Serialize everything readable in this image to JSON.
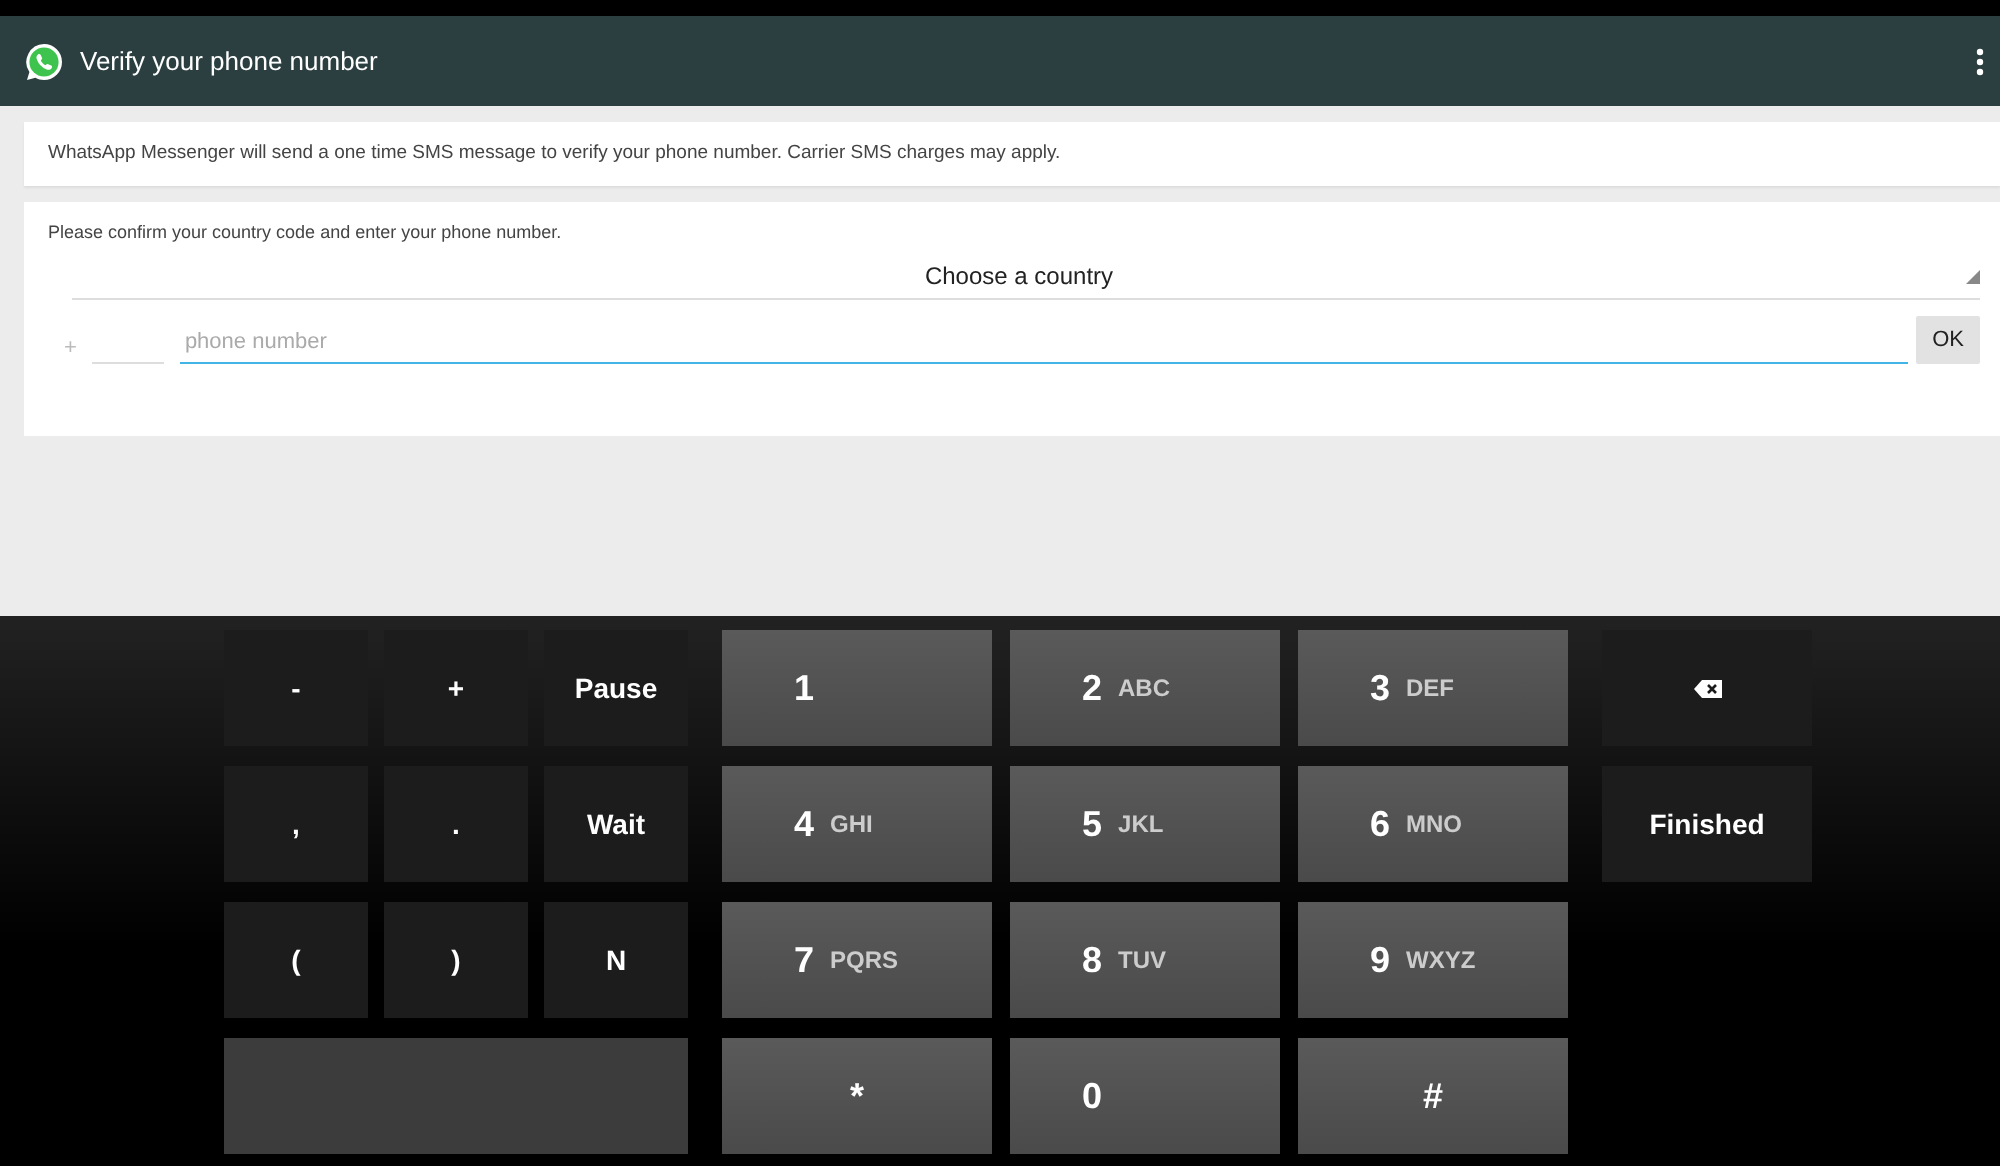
{
  "header": {
    "title": "Verify your phone number"
  },
  "notice": "WhatsApp Messenger will send a one time SMS message to verify your phone number. Carrier SMS charges may apply.",
  "form": {
    "instruction": "Please confirm your country code and enter your phone number.",
    "country": "Choose a country",
    "plus": "+",
    "phone": {
      "placeholder": "phone number",
      "focused": true
    },
    "ok": "OK"
  },
  "keypad": {
    "rows": [
      [
        {
          "kind": "sym",
          "label": "-"
        },
        {
          "kind": "sym",
          "label": "+"
        },
        {
          "kind": "sym",
          "label": "Pause"
        },
        {
          "kind": "digit",
          "label": "1"
        },
        {
          "kind": "digit",
          "label": "2",
          "letters": "ABC"
        },
        {
          "kind": "digit",
          "label": "3",
          "letters": "DEF"
        },
        {
          "kind": "backspace"
        }
      ],
      [
        {
          "kind": "sym",
          "label": ","
        },
        {
          "kind": "sym",
          "label": "."
        },
        {
          "kind": "sym",
          "label": "Wait"
        },
        {
          "kind": "digit",
          "label": "4",
          "letters": "GHI"
        },
        {
          "kind": "digit",
          "label": "5",
          "letters": "JKL"
        },
        {
          "kind": "digit",
          "label": "6",
          "letters": "MNO"
        },
        {
          "kind": "action",
          "label": "Finished"
        }
      ],
      [
        {
          "kind": "sym",
          "label": "("
        },
        {
          "kind": "sym",
          "label": ")"
        },
        {
          "kind": "sym",
          "label": "N"
        },
        {
          "kind": "digit",
          "label": "7",
          "letters": "PQRS"
        },
        {
          "kind": "digit",
          "label": "8",
          "letters": "TUV"
        },
        {
          "kind": "digit",
          "label": "9",
          "letters": "WXYZ"
        }
      ],
      [
        {
          "kind": "space"
        },
        "",
        "",
        {
          "kind": "center",
          "label": "*"
        },
        {
          "kind": "digit",
          "label": "0"
        },
        {
          "kind": "center",
          "label": "#"
        }
      ]
    ]
  }
}
